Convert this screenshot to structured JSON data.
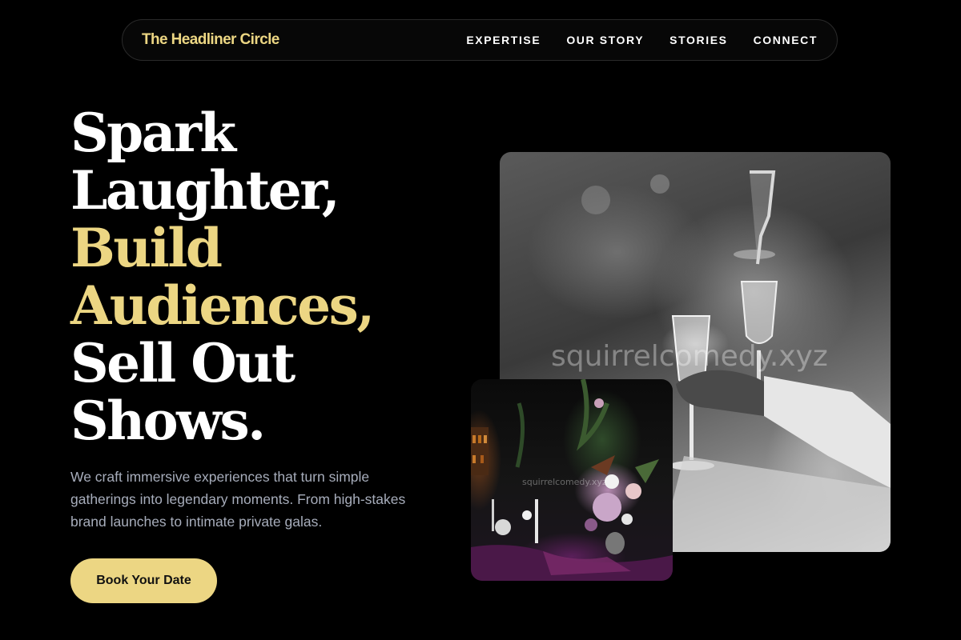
{
  "nav": {
    "brand": "The Headliner Circle",
    "links": [
      "EXPERTISE",
      "OUR STORY",
      "STORIES",
      "CONNECT"
    ]
  },
  "hero": {
    "title_lines": [
      "Spark",
      "Laughter,",
      "Build",
      "Audiences,",
      "Sell Out",
      "Shows."
    ],
    "description": "We craft immersive experiences that turn simple gatherings into legendary moments. From high-stakes brand launches to intimate private galas.",
    "cta_label": "Book Your Date"
  },
  "images": {
    "main_watermark": "squirrelcomedy.xyz",
    "small_watermark": "squirrelcomedy.xyz"
  },
  "colors": {
    "accent": "#ecd683",
    "background": "#000000",
    "body_text": "#a7adbb"
  }
}
